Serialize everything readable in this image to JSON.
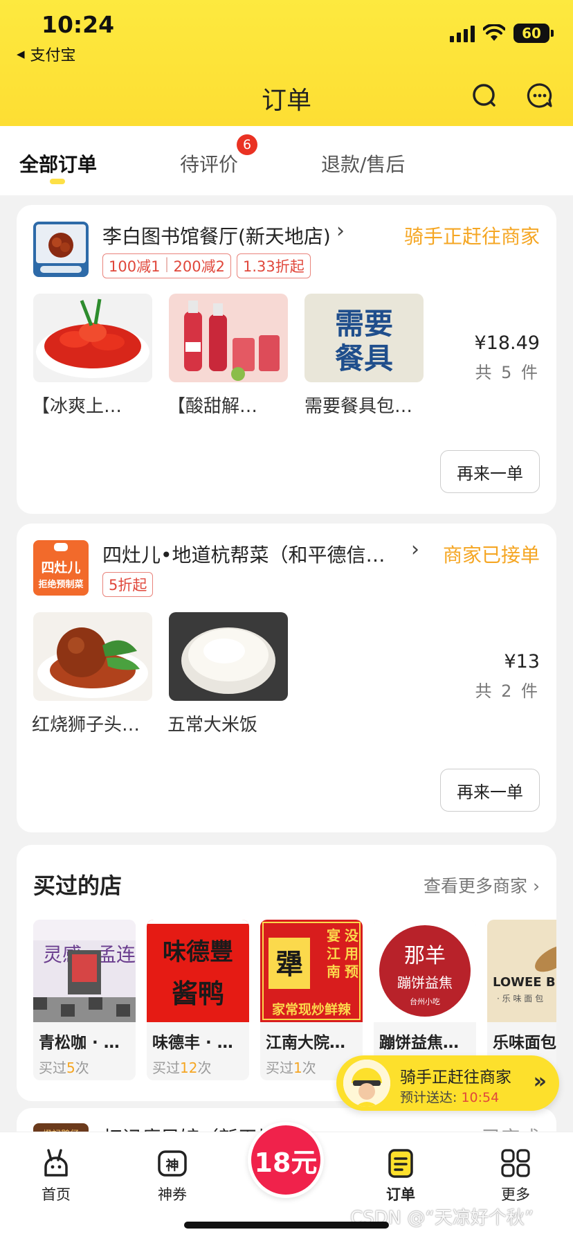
{
  "status_bar": {
    "time": "10:24",
    "back_app": "支付宝",
    "battery": "60"
  },
  "header": {
    "title": "订单",
    "search_icon": "search-icon",
    "message_icon": "chat-bubble-icon"
  },
  "tabs": [
    {
      "label": "全部订单",
      "active": true
    },
    {
      "label": "待评价",
      "badge": "6"
    },
    {
      "label": "退款/售后"
    }
  ],
  "orders": [
    {
      "store": "李白图书馆餐厅(新天地店)",
      "status": "骑手正赶往商家",
      "tags": [
        "100减1",
        "200减2",
        "1.33折起"
      ],
      "items": [
        {
          "label": "【冰爽上…"
        },
        {
          "label": "【酸甜解…"
        },
        {
          "label": "需要餐具包…",
          "image_text": "需要餐具"
        }
      ],
      "price": "¥18.49",
      "count": "共 5 件",
      "reorder": "再来一单"
    },
    {
      "store": "四灶儿•地道杭帮菜（和平德信…",
      "status": "商家已接单",
      "logo_text": "四灶儿 拒绝预制菜",
      "tags": [
        "5折起"
      ],
      "items": [
        {
          "label": "红烧狮子头…"
        },
        {
          "label": "五常大米饭"
        }
      ],
      "price": "¥13",
      "count": "共 2 件",
      "reorder": "再来一单"
    }
  ],
  "bought_shops": {
    "title": "买过的店",
    "more": "查看更多商家",
    "shops": [
      {
        "name": "青松咖 · …",
        "times_prefix": "买过",
        "times": "5",
        "times_suffix": "次"
      },
      {
        "name": "味德丰 · …",
        "times_prefix": "买过",
        "times": "12",
        "times_suffix": "次"
      },
      {
        "name": "江南大院…",
        "times_prefix": "买过",
        "times": "1",
        "times_suffix": "次"
      },
      {
        "name": "蹦饼益焦…"
      },
      {
        "name": "乐味面包"
      }
    ]
  },
  "partial_order": {
    "store": "灯记瘦风馆（新天地…",
    "status": "已完成"
  },
  "rider_toast": {
    "title": "骑手正赶往商家",
    "eta_label": "预计送达:",
    "eta_time": "10:54"
  },
  "bottom_nav": [
    {
      "label": "首页",
      "icon": "rabbit-home-icon"
    },
    {
      "label": "神券",
      "icon": "coupon-icon"
    },
    {
      "label": "18元",
      "center": true
    },
    {
      "label": "订单",
      "icon": "order-icon",
      "active": true
    },
    {
      "label": "更多",
      "icon": "grid-icon"
    }
  ],
  "watermark": "CSDN @“天凉好个秋”"
}
